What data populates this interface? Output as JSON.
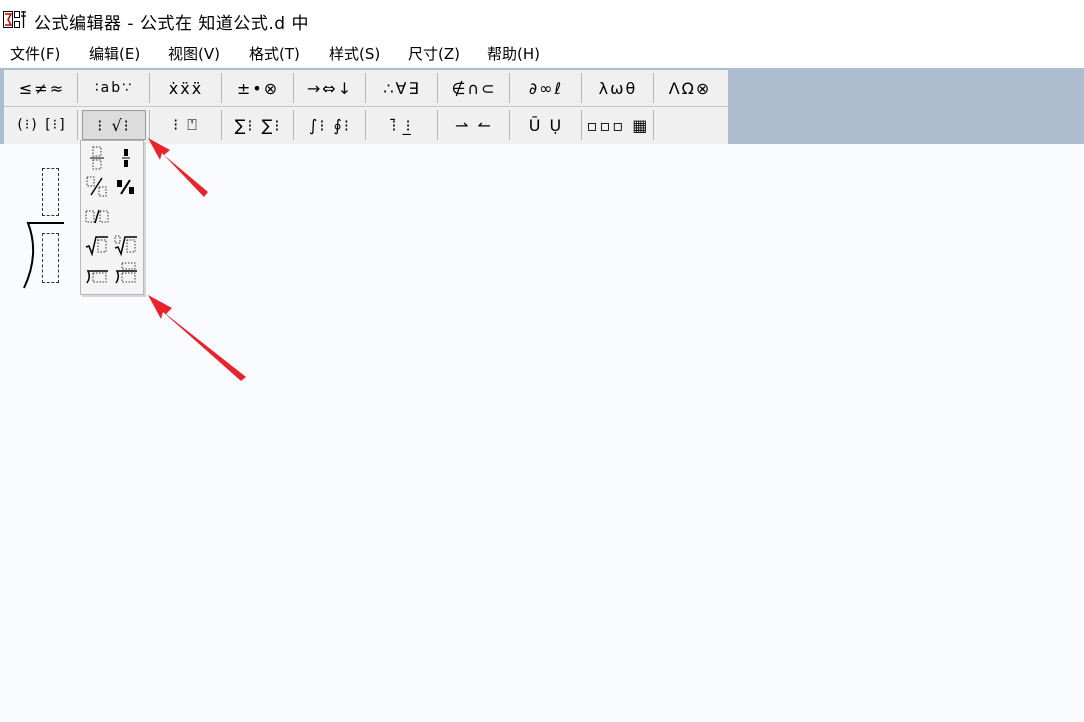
{
  "window": {
    "title": "公式编辑器 - 公式在 知道公式.d 中",
    "app_icon": "equation-editor-icon"
  },
  "menu": {
    "items": [
      {
        "label": "文件(F)"
      },
      {
        "label": "编辑(E)"
      },
      {
        "label": "视图(V)"
      },
      {
        "label": "格式(T)"
      },
      {
        "label": "样式(S)"
      },
      {
        "label": "尺寸(Z)"
      },
      {
        "label": "帮助(H)"
      }
    ]
  },
  "toolbar": {
    "row1": [
      {
        "label": "≤≠≈",
        "icon": "relational-symbols-icon"
      },
      {
        "label": "∶ab∵",
        "icon": "spaces-ellipses-icon"
      },
      {
        "label": "ẋẍẍ",
        "icon": "embellishments-icon"
      },
      {
        "label": "±•⊗",
        "icon": "operator-symbols-icon"
      },
      {
        "label": "→⇔↓",
        "icon": "arrow-symbols-icon"
      },
      {
        "label": "∴∀∃",
        "icon": "logical-symbols-icon"
      },
      {
        "label": "∉∩⊂",
        "icon": "set-theory-symbols-icon"
      },
      {
        "label": "∂∞ℓ",
        "icon": "misc-symbols-icon"
      },
      {
        "label": "λωθ",
        "icon": "greek-lowercase-icon"
      },
      {
        "label": "ΛΩ⊗",
        "icon": "greek-uppercase-icon"
      }
    ],
    "row2": [
      {
        "label": "(⁝) [⁝]",
        "icon": "fence-templates-icon"
      },
      {
        "label": "⁝ √⁝",
        "icon": "fraction-radical-templates-icon"
      },
      {
        "label": "⁝ ⍞",
        "icon": "subscript-superscript-templates-icon"
      },
      {
        "label": "∑⁝ ∑⁝",
        "icon": "summation-templates-icon"
      },
      {
        "label": "∫⁝ ∮⁝",
        "icon": "integral-templates-icon"
      },
      {
        "label": "⁝̄ ⁝̲",
        "icon": "underbar-overbar-templates-icon"
      },
      {
        "label": "⇀ ↼",
        "icon": "labeled-arrow-templates-icon"
      },
      {
        "label": "Ū Ụ",
        "icon": "products-set-theory-templates-icon"
      },
      {
        "label": "▫▫▫ ▦",
        "icon": "matrix-templates-icon"
      }
    ]
  },
  "palette": {
    "items": [
      {
        "icon": "full-size-fraction-icon"
      },
      {
        "icon": "small-fraction-icon"
      },
      {
        "icon": "slash-fraction-icon"
      },
      {
        "icon": "small-slash-fraction-icon"
      },
      {
        "icon": "baseline-slash-fraction-icon"
      },
      {
        "icon": "square-root-icon"
      },
      {
        "icon": "nth-root-icon"
      },
      {
        "icon": "long-division-icon"
      },
      {
        "icon": "long-division-with-quotient-icon"
      }
    ]
  },
  "colors": {
    "arrow": "#e8232a",
    "toolbar_accent": "#aebcd0",
    "canvas": "#fafbfe"
  }
}
